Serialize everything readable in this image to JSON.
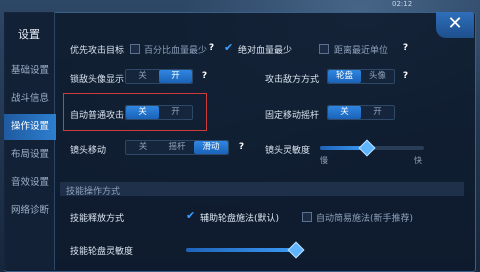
{
  "status": {
    "time": "02:12"
  },
  "sidebar": {
    "title": "设置",
    "items": [
      {
        "label": "基础设置"
      },
      {
        "label": "战斗信息"
      },
      {
        "label": "操作设置"
      },
      {
        "label": "布局设置"
      },
      {
        "label": "音效设置"
      },
      {
        "label": "网络诊断"
      }
    ],
    "active_index": 2
  },
  "close": {
    "glyph": "✕"
  },
  "settings": {
    "priority_target": {
      "label": "优先攻击目标",
      "options": [
        {
          "label": "百分比血量最少",
          "checked": false
        },
        {
          "label": "绝对血量最少",
          "checked": true
        },
        {
          "label": "距离最近单位",
          "checked": false
        }
      ]
    },
    "lock_head": {
      "label": "锁敌头像显示",
      "off": "关",
      "on": "开",
      "selected": "开"
    },
    "attack_enemy": {
      "label": "攻击敌方方式",
      "opt1": "轮盘",
      "opt2": "头像",
      "selected": "轮盘"
    },
    "auto_attack": {
      "label": "自动普通攻击",
      "off": "关",
      "on": "开",
      "selected": "关"
    },
    "fixed_joystick": {
      "label": "固定移动摇杆",
      "off": "关",
      "on": "开",
      "selected": "关"
    },
    "camera_move": {
      "label": "镜头移动",
      "opt1": "关",
      "opt2": "摇杆",
      "opt3": "滑动",
      "selected": "滑动"
    },
    "camera_sensitivity": {
      "label": "镜头灵敏度",
      "slow": "慢",
      "fast": "快",
      "value": 0.45
    },
    "skill_section": {
      "title": "技能操作方式"
    },
    "skill_cast": {
      "label": "技能释放方式",
      "opt1": "辅助轮盘施法(默认)",
      "opt1_checked": true,
      "opt2": "自动简易施法(新手推荐)",
      "opt2_checked": false
    },
    "skill_wheel_sensitivity": {
      "label": "技能轮盘灵敏度",
      "value": 0.98
    }
  },
  "help_glyph": "?",
  "colors": {
    "accent": "#2f86e0",
    "highlight_box": "#d13a3a"
  }
}
